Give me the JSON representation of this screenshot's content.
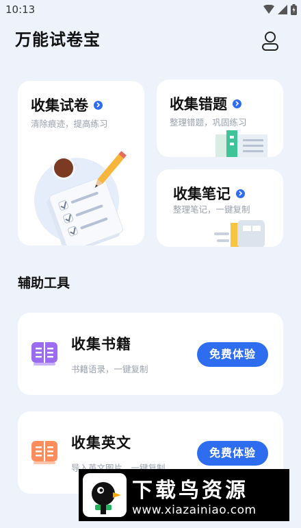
{
  "status_bar": {
    "time": "10:13"
  },
  "app": {
    "title": "万能试卷宝"
  },
  "cards": {
    "collect_paper": {
      "title": "收集试卷",
      "subtitle": "清除痕迹，提高练习"
    },
    "collect_errors": {
      "title": "收集错题",
      "subtitle": "整理错题，巩固练习"
    },
    "collect_notes": {
      "title": "收集笔记",
      "subtitle": "整理笔记，一键复制"
    }
  },
  "tools": {
    "section_title": "辅助工具",
    "items": [
      {
        "name": "收集书籍",
        "desc": "书籍语录，一键复制",
        "button": "免费体验",
        "icon": "book-icon",
        "color": "#9b6cf0"
      },
      {
        "name": "收集英文",
        "desc": "导入英文图片，一键复制",
        "button": "免费体验",
        "icon": "book-icon",
        "color": "#ff8d5c"
      }
    ]
  },
  "watermark": {
    "brand": "下载鸟资源",
    "url": "www.xiazainiao.com"
  },
  "colors": {
    "accent": "#2f6df0",
    "background": "#eef2fa"
  }
}
